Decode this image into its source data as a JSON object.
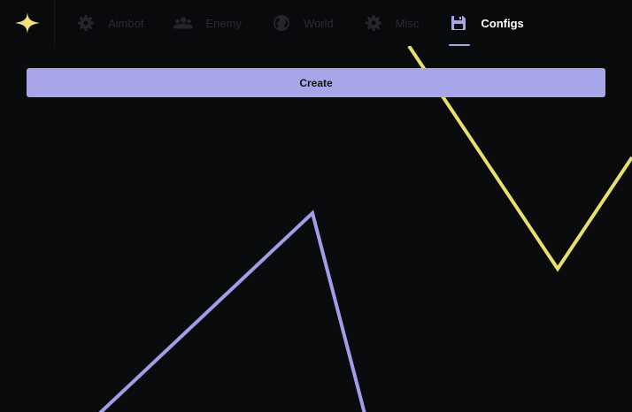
{
  "nav": {
    "tabs": [
      {
        "label": "Aimbot",
        "icon": "gear-icon",
        "active": false
      },
      {
        "label": "Enemy",
        "icon": "users-icon",
        "active": false
      },
      {
        "label": "World",
        "icon": "globe-icon",
        "active": false
      },
      {
        "label": "Misc",
        "icon": "gear-icon",
        "active": false
      },
      {
        "label": "Configs",
        "icon": "floppy-disk-icon",
        "active": true
      }
    ]
  },
  "main": {
    "create_label": "Create"
  },
  "colors": {
    "accent": "#a6a6e9",
    "logo": "#f2e27a",
    "yellow_line": "#e9dd6e",
    "purple_line": "#9f9ee6",
    "background": "#0a0b0d"
  }
}
